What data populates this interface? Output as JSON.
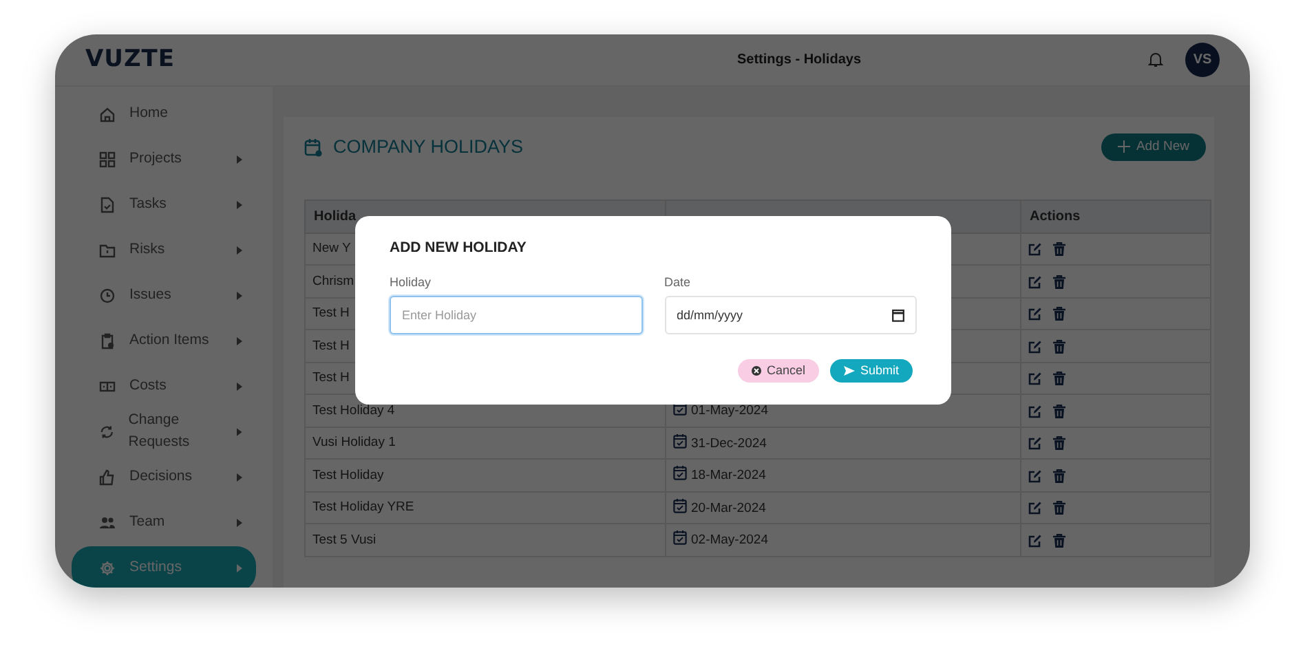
{
  "app": {
    "logo": "VUZTE",
    "page_title": "Settings - Holidays",
    "avatar": "VS"
  },
  "sidebar": {
    "items": [
      {
        "label": "Home",
        "submenu": false,
        "selected": false
      },
      {
        "label": "Projects",
        "submenu": true,
        "selected": false
      },
      {
        "label": "Tasks",
        "submenu": true,
        "selected": false
      },
      {
        "label": "Risks",
        "submenu": true,
        "selected": false
      },
      {
        "label": "Issues",
        "submenu": true,
        "selected": false
      },
      {
        "label": "Action Items",
        "submenu": true,
        "selected": false
      },
      {
        "label": "Costs",
        "submenu": true,
        "selected": false
      },
      {
        "label": "Change Requests",
        "submenu": true,
        "selected": false
      },
      {
        "label": "Decisions",
        "submenu": true,
        "selected": false
      },
      {
        "label": "Team",
        "submenu": true,
        "selected": false
      },
      {
        "label": "Settings",
        "submenu": true,
        "selected": true
      }
    ]
  },
  "card": {
    "title": "COMPANY HOLIDAYS",
    "add_button": "Add New"
  },
  "table": {
    "columns": [
      {
        "kind": "text",
        "label": "Holida"
      },
      {
        "kind": "date"
      },
      {
        "kind": "actions",
        "label": "Actions"
      }
    ],
    "rows": [
      {
        "holiday": "New Y"
      },
      {
        "holiday": "Chrism"
      },
      {
        "holiday": "Test H"
      },
      {
        "holiday": "Test H"
      },
      {
        "holiday": "Test H"
      },
      {
        "holiday": "Test Holiday 4",
        "date": "01-May-2024"
      },
      {
        "holiday": "Vusi Holiday 1",
        "date": "31-Dec-2024"
      },
      {
        "holiday": "Test Holiday",
        "date": "18-Mar-2024"
      },
      {
        "holiday": "Test Holiday YRE",
        "date": "20-Mar-2024"
      },
      {
        "holiday": "Test 5 Vusi",
        "date": "02-May-2024"
      }
    ]
  },
  "modal": {
    "title": "ADD NEW HOLIDAY",
    "fields": [
      {
        "label": "Holiday",
        "placeholder": "Enter Holiday",
        "kind": "text",
        "focused": true
      },
      {
        "label": "Date",
        "placeholder": "dd/mm/yyyy",
        "kind": "date",
        "focused": false
      }
    ],
    "buttons": [
      {
        "label": "Cancel",
        "kind": "cancel"
      },
      {
        "label": "Submit",
        "kind": "submit"
      }
    ]
  }
}
